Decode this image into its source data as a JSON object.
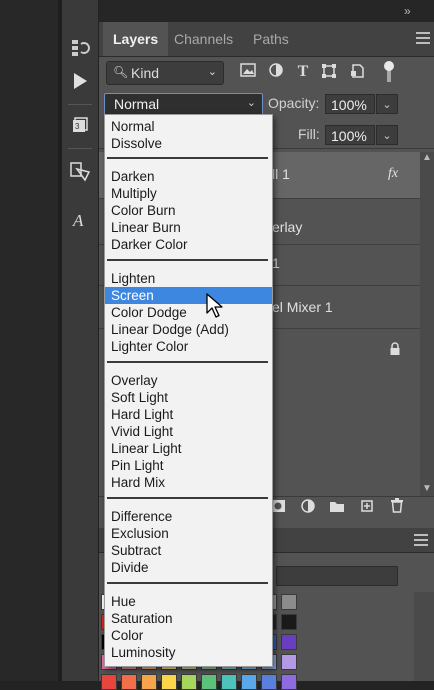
{
  "side_toolbar": {
    "top_arrows": "‹‹",
    "icons": [
      "history-icon",
      "play-icon",
      "3d-cube-icon",
      "adjust-icon",
      "character-icon"
    ]
  },
  "panel": {
    "collapse_arrows": "»",
    "tabs": [
      {
        "label": "Layers",
        "active": true
      },
      {
        "label": "Channels",
        "active": false
      },
      {
        "label": "Paths",
        "active": false
      }
    ],
    "filter": {
      "kind_label": "Kind",
      "icons": [
        "image-filter-icon",
        "adjustment-filter-icon",
        "type-filter-icon",
        "shape-filter-icon",
        "smart-object-filter-icon"
      ]
    },
    "blend": {
      "value": "Normal",
      "opacity_label": "Opacity:",
      "opacity_value": "100%",
      "fill_label": "Fill:",
      "fill_value": "100%"
    },
    "layers_partial": [
      {
        "text": "ll 1",
        "fx": "fx"
      },
      {
        "text": "erlay"
      },
      {
        "text": "1"
      },
      {
        "text": "el Mixer 1"
      },
      {
        "text": "",
        "lock": true
      }
    ],
    "footer_icons": [
      "link-icon",
      "fx-icon",
      "mask-icon",
      "adjustment-layer-icon",
      "group-folder-icon",
      "new-layer-icon",
      "trash-icon"
    ]
  },
  "blend_menu": {
    "selected": "Screen",
    "groups": [
      [
        "Normal",
        "Dissolve"
      ],
      [
        "Darken",
        "Multiply",
        "Color Burn",
        "Linear Burn",
        "Darker Color"
      ],
      [
        "Lighten",
        "Screen",
        "Color Dodge",
        "Linear Dodge (Add)",
        "Lighter Color"
      ],
      [
        "Overlay",
        "Soft Light",
        "Hard Light",
        "Vivid Light",
        "Linear Light",
        "Pin Light",
        "Hard Mix"
      ],
      [
        "Difference",
        "Exclusion",
        "Subtract",
        "Divide"
      ],
      [
        "Hue",
        "Saturation",
        "Color",
        "Luminosity"
      ]
    ]
  },
  "swatch_colors": {
    "row1": [
      "#ffffff",
      "#f2f2f2",
      "#e6e6e6",
      "#d9d9d9",
      "#cccccc",
      "#bfbfbf",
      "#b3b3b3",
      "#a6a6a6",
      "#999999",
      "#8c8c8c"
    ],
    "row2": [
      "#e0231b",
      "#7f7f7f",
      "#737373",
      "#666666",
      "#595959",
      "#4d4d4d",
      "#404040",
      "#333333",
      "#262626",
      "#1a1a1a"
    ],
    "row3": [
      "#000000",
      "#d93a3a",
      "#e8772a",
      "#f5c322",
      "#8cc63f",
      "#2ea54f",
      "#21a6a0",
      "#2d8bd9",
      "#2e5fbf",
      "#6a3fbf"
    ],
    "row4": [
      "#f06ea9",
      "#f38d8d",
      "#f5b37a",
      "#fae27a",
      "#c7e28a",
      "#8fd19e",
      "#87d6d1",
      "#8ac4ef",
      "#8aa9e8",
      "#b49ae6"
    ],
    "row5": [
      "#e8453c",
      "#f26f4a",
      "#f7a54a",
      "#fbd64a",
      "#a6d65b",
      "#5cc27a",
      "#4ec3bd",
      "#5aa8ea",
      "#5a80dd",
      "#8f6ae0"
    ]
  },
  "colors": {
    "menu_highlight": "#3e87e0",
    "panel_bg": "#535353",
    "tab_bar_bg": "#424242"
  }
}
